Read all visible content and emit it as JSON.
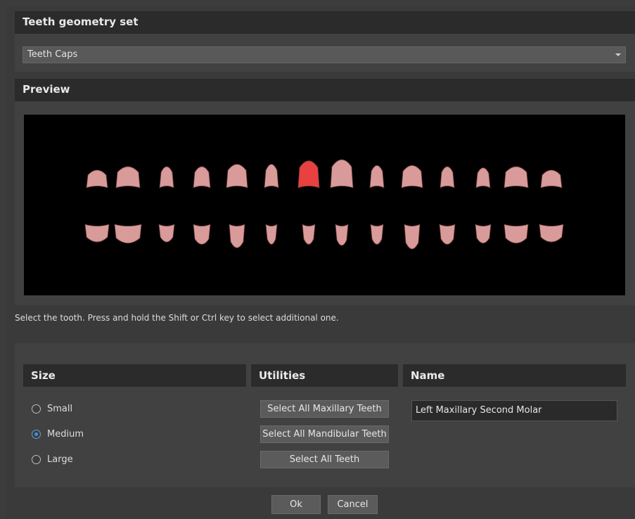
{
  "geometry_set": {
    "title": "Teeth geometry set",
    "selected": "Teeth Caps"
  },
  "preview": {
    "title": "Preview",
    "selected_tooth": "upper-7"
  },
  "hint": "Select the tooth. Press and hold the Shift or Ctrl key to select additional one.",
  "size": {
    "title": "Size",
    "options": [
      {
        "label": "Small",
        "checked": false
      },
      {
        "label": "Medium",
        "checked": true
      },
      {
        "label": "Large",
        "checked": false
      }
    ]
  },
  "utilities": {
    "title": "Utilities",
    "buttons": [
      "Select All Maxillary Teeth",
      "Select All Mandibular Teeth",
      "Select All Teeth"
    ]
  },
  "name": {
    "title": "Name",
    "value": "Left Maxillary Second Molar"
  },
  "footer": {
    "ok_label": "Ok",
    "cancel_label": "Cancel"
  },
  "colors": {
    "tooth": "#d99a9a",
    "tooth_selected": "#e8413f"
  }
}
